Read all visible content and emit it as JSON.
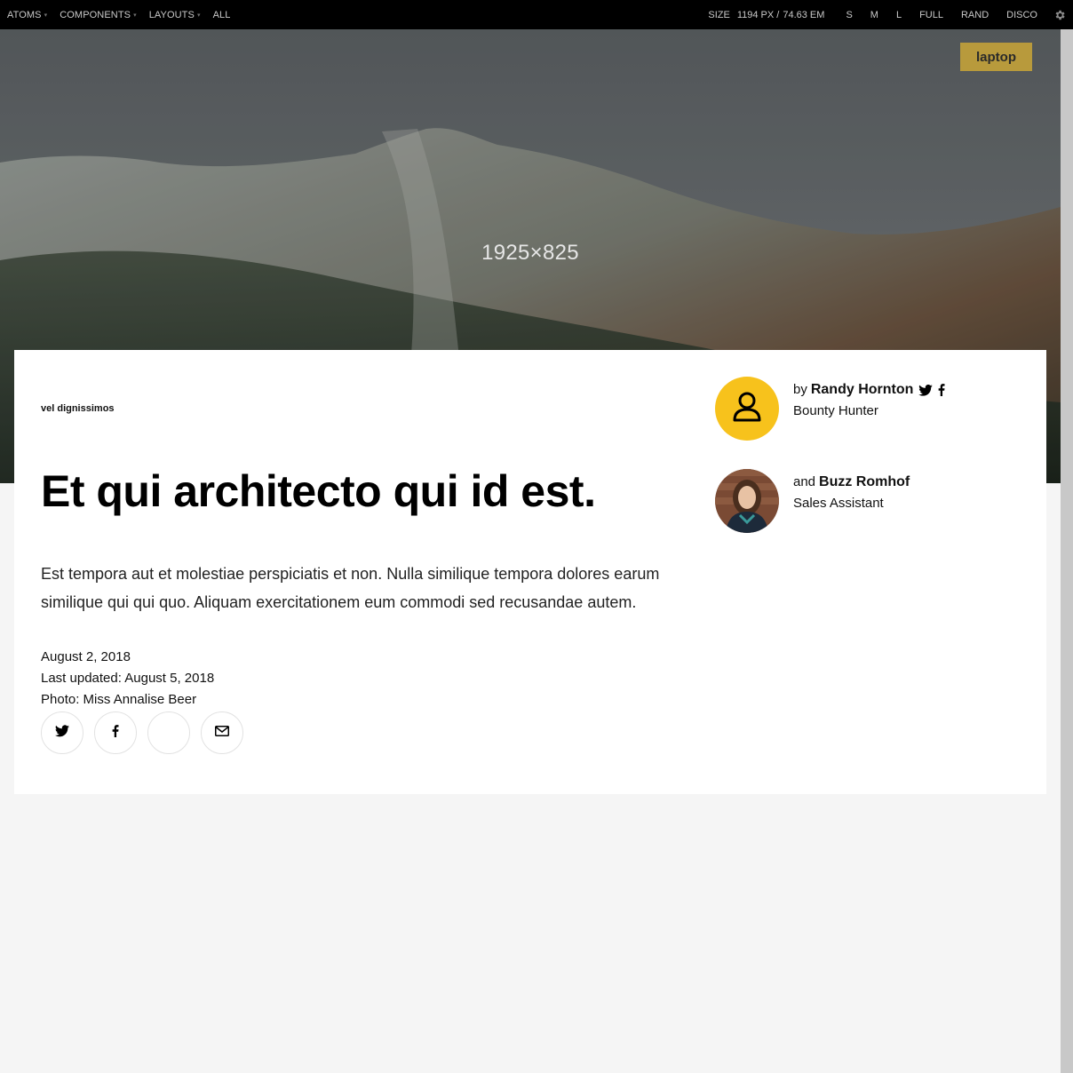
{
  "toolbar": {
    "nav": [
      {
        "label": "ATOMS",
        "caret": "▾"
      },
      {
        "label": "COMPONENTS",
        "caret": "▾"
      },
      {
        "label": "LAYOUTS",
        "caret": "▾"
      },
      {
        "label": "ALL",
        "caret": ""
      }
    ],
    "size_label": "SIZE",
    "size_px": "1194 PX /",
    "size_em": "74.63 EM",
    "viewport_buttons": [
      "S",
      "M",
      "L",
      "FULL",
      "RAND",
      "DISCO"
    ],
    "settings_icon": "gear-icon"
  },
  "hero": {
    "caption": "1925×825",
    "badge": "laptop"
  },
  "article": {
    "kicker": "vel dignissimos",
    "headline": "Et qui architecto qui id est.",
    "dek": "Est tempora aut et molestiae perspiciatis et non. Nulla similique tempora dolores earum similique qui qui quo. Aliquam exercitationem eum commodi sed recusandae autem.",
    "published": "August 2, 2018",
    "updated": "Last updated: August 5, 2018",
    "photo_credit": "Photo: Miss Annalise Beer",
    "share_icons": [
      "twitter-icon",
      "facebook-icon",
      "blank",
      "email-icon"
    ]
  },
  "authors": [
    {
      "prefix": "by",
      "name": "Randy Hornton",
      "role": "Bounty Hunter",
      "avatar": "user-placeholder-icon",
      "social": [
        "twitter-icon",
        "facebook-icon"
      ]
    },
    {
      "prefix": "and",
      "name": "Buzz Romhof",
      "role": "Sales Assistant",
      "avatar": "photo"
    }
  ],
  "colors": {
    "toolbar_bg": "#000000",
    "badge_bg": "#b89a3c",
    "avatar_yellow": "#f7c21c",
    "page_bg": "#f5f5f5"
  }
}
